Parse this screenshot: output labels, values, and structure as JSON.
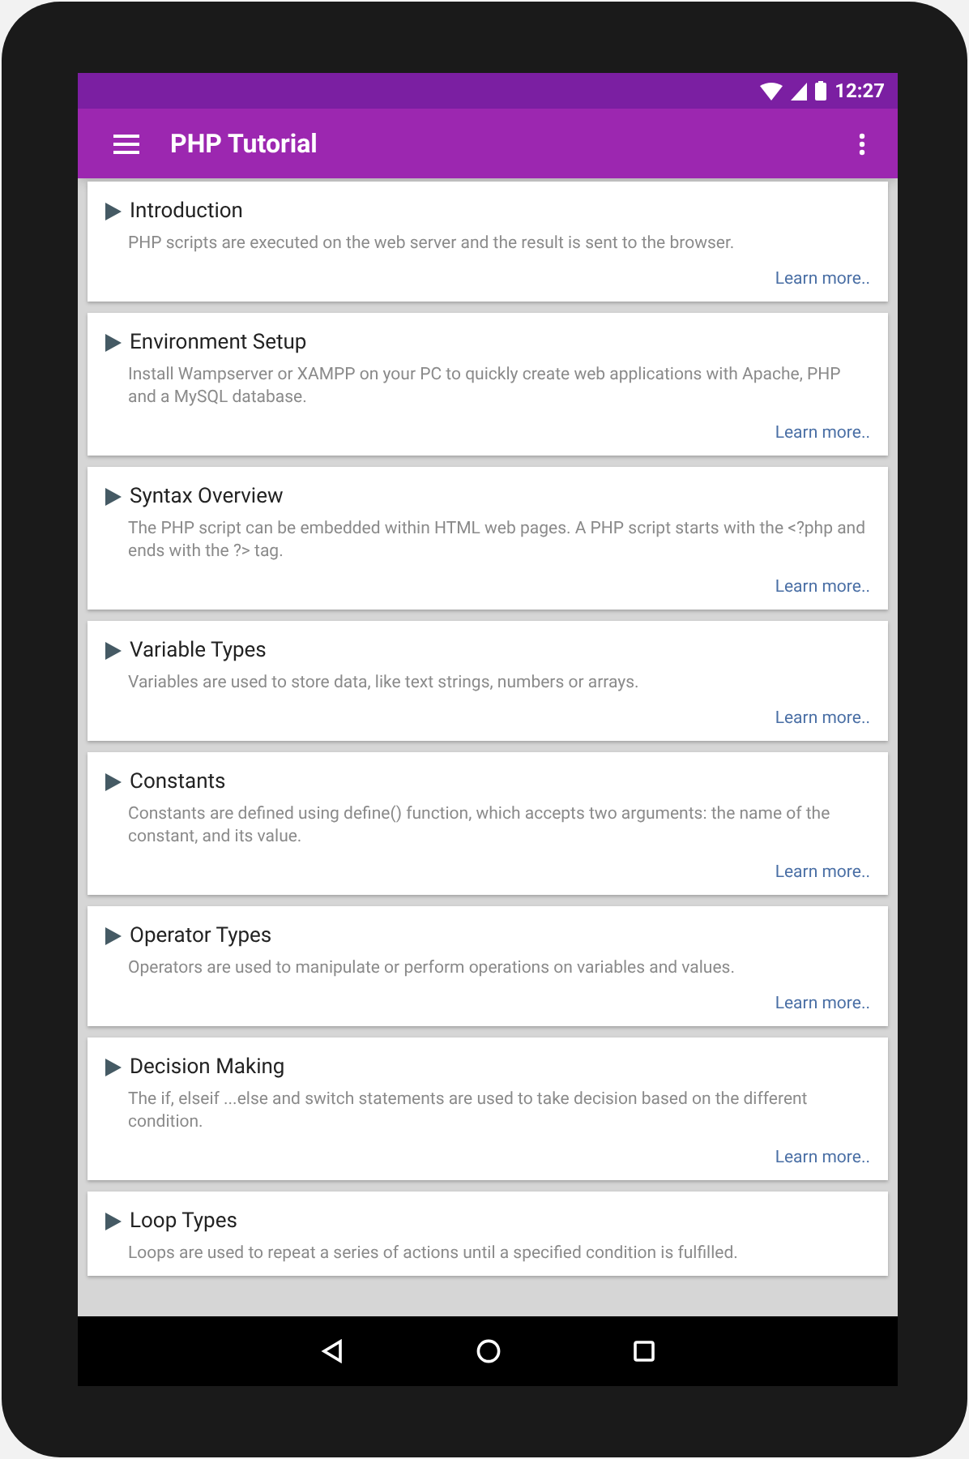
{
  "status_bar": {
    "time": "12:27"
  },
  "app_bar": {
    "title": "PHP Tutorial"
  },
  "topics": [
    {
      "title": "Introduction",
      "description": "PHP scripts are executed on the web server and the result is sent to the browser.",
      "link": "Learn more.."
    },
    {
      "title": "Environment Setup",
      "description": "Install Wampserver or XAMPP on your PC to quickly create web applications with Apache, PHP and a MySQL database.",
      "link": "Learn more.."
    },
    {
      "title": "Syntax Overview",
      "description": "The PHP script can be embedded within HTML web pages. A PHP script starts with the <?php and ends with the ?> tag.",
      "link": "Learn more.."
    },
    {
      "title": "Variable Types",
      "description": "Variables are used to store data, like text strings, numbers or arrays.",
      "link": "Learn more.."
    },
    {
      "title": "Constants",
      "description": "Constants are defined using define() function, which accepts two arguments: the name of the constant, and its value.",
      "link": "Learn more.."
    },
    {
      "title": "Operator Types",
      "description": "Operators are used to manipulate or perform operations on variables and values.",
      "link": "Learn more.."
    },
    {
      "title": "Decision Making",
      "description": "The if, elseif ...else and switch statements are used to take decision based on the different condition.",
      "link": "Learn more.."
    },
    {
      "title": "Loop Types",
      "description": "Loops are used to repeat a series of actions until a specified condition is fulfilled."
    }
  ]
}
